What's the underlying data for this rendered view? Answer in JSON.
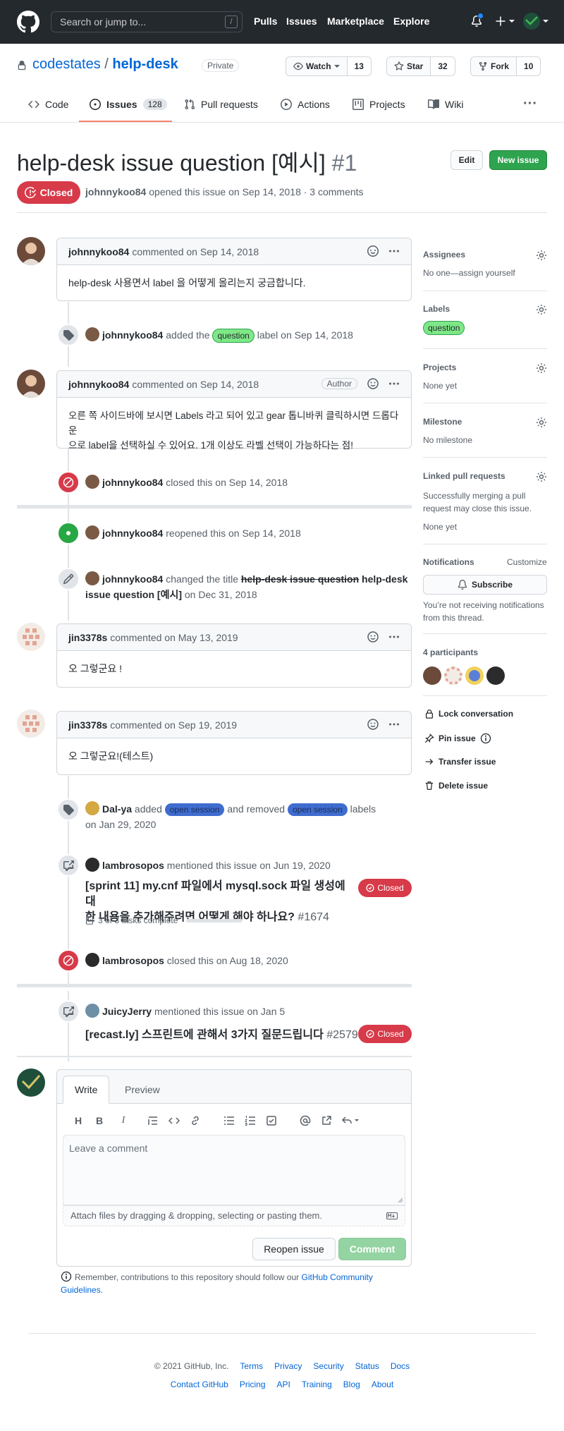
{
  "header": {
    "search_placeholder": "Search or jump to...",
    "slash_key": "/",
    "nav": [
      "Pulls",
      "Issues",
      "Marketplace",
      "Explore"
    ]
  },
  "repo": {
    "owner": "codestates",
    "separator": "/",
    "name": "help-desk",
    "visibility": "Private",
    "watch_label": "Watch",
    "watch_count": "13",
    "star_label": "Star",
    "star_count": "32",
    "fork_label": "Fork",
    "fork_count": "10"
  },
  "tabs": {
    "code": "Code",
    "issues": "Issues",
    "issues_count": "128",
    "pulls": "Pull requests",
    "actions": "Actions",
    "projects": "Projects",
    "wiki": "Wiki",
    "more": "···"
  },
  "issue": {
    "title": "help-desk issue question [예시]",
    "number": "#1",
    "edit_label": "Edit",
    "new_issue_label": "New issue",
    "state": "Closed",
    "author": "johnnykoo84",
    "meta": "opened this issue on Sep 14, 2018 · 3 comments"
  },
  "timeline": {
    "c1": {
      "author": "johnnykoo84",
      "meta": "commented on Sep 14, 2018",
      "body": "help-desk 사용면서 label 을 어떻게 올리는지 궁금합니다."
    },
    "e1": {
      "actor": "johnnykoo84",
      "pre": "added the",
      "label": "question",
      "post": "label on Sep 14, 2018"
    },
    "c2": {
      "author": "johnnykoo84",
      "meta": "commented on Sep 14, 2018",
      "badge": "Author",
      "body_line1": "오른 쪽 사이드바에 보시면 Labels 라고 되어 있고 gear 톱니바퀴 클릭하시면 드롭다운",
      "body_line2": "으로 label을 선택하실 수 있어요. 1개 이상도 라벨 선택이 가능하다는 점!"
    },
    "e2": {
      "actor": "johnnykoo84",
      "text": "closed this on Sep 14, 2018"
    },
    "e3": {
      "actor": "johnnykoo84",
      "text": "reopened this on Sep 14, 2018"
    },
    "e4": {
      "actor": "johnnykoo84",
      "pre": "changed the title",
      "old_title": "help-desk issue question",
      "new_title_1": "help-desk",
      "new_title_2": "issue question [예시]",
      "post": "on Dec 31, 2018"
    },
    "c3": {
      "author": "jin3378s",
      "meta": "commented on May 13, 2019",
      "body": "오 그렇군요 !"
    },
    "c4": {
      "author": "jin3378s",
      "meta": "commented on Sep 19, 2019",
      "body": "오 그렇군요!(테스트)"
    },
    "e5": {
      "actor": "Dal-ya",
      "pre": "added",
      "label_added": "open session",
      "mid": "and removed",
      "label_removed": "open session",
      "post": "labels",
      "date": "on Jan 29, 2020"
    },
    "e6": {
      "actor": "lambrosopos",
      "text": "mentioned this issue on Jun 19, 2020",
      "ref_title_1": "[sprint 11] my.cnf 파일에서 mysql.sock 파일 생성에 대",
      "ref_title_2": "한 내용을 추가해주려면 어떻게 해야 하나요?",
      "ref_num": "#1674",
      "tasks": "3 of 3 tasks complete",
      "tasks_fraction": 1.0,
      "state": "Closed"
    },
    "e7": {
      "actor": "lambrosopos",
      "text": "closed this on Aug 18, 2020"
    },
    "e8": {
      "actor": "JuicyJerry",
      "text": "mentioned this issue on Jan 5",
      "ref_title": "[recast.ly] 스프린트에 관해서 3가지 질문드립니다",
      "ref_num": "#2579",
      "state": "Closed"
    }
  },
  "editor": {
    "tab_write": "Write",
    "tab_preview": "Preview",
    "placeholder": "Leave a comment",
    "attach_text": "Attach files by dragging & dropping, selecting or pasting them.",
    "reopen_label": "Reopen issue",
    "comment_label": "Comment",
    "guideline_pre": "Remember, contributions to this repository should follow our",
    "guideline_link_1": "GitHub Community",
    "guideline_link_2": "Guidelines",
    "guideline_post": "."
  },
  "sidebar": {
    "assignees_h": "Assignees",
    "assignees_v": "No one—assign yourself",
    "labels_h": "Labels",
    "label_question": "question",
    "projects_h": "Projects",
    "projects_v": "None yet",
    "milestone_h": "Milestone",
    "milestone_v": "No milestone",
    "linked_h": "Linked pull requests",
    "linked_desc_1": "Successfully merging a pull",
    "linked_desc_2": "request may close this issue.",
    "linked_v": "None yet",
    "notif_h": "Notifications",
    "customize": "Customize",
    "subscribe": "Subscribe",
    "notif_desc_1": "You’re not receiving notifications",
    "notif_desc_2": "from this thread.",
    "participants_h": "4 participants",
    "lock": "Lock conversation",
    "pin": "Pin issue",
    "transfer": "Transfer issue",
    "delete": "Delete issue"
  },
  "footer": {
    "copyright": "© 2021 GitHub, Inc.",
    "row1": [
      "Terms",
      "Privacy",
      "Security",
      "Status",
      "Docs"
    ],
    "row2": [
      "Contact GitHub",
      "Pricing",
      "API",
      "Training",
      "Blog",
      "About"
    ]
  },
  "colors": {
    "header_bg": "#24292e",
    "closed_red": "#d73a49",
    "open_green": "#28a745",
    "link_blue": "#0366d6",
    "label_question": "#7ee787",
    "label_open_session": "#3f6ccf"
  }
}
